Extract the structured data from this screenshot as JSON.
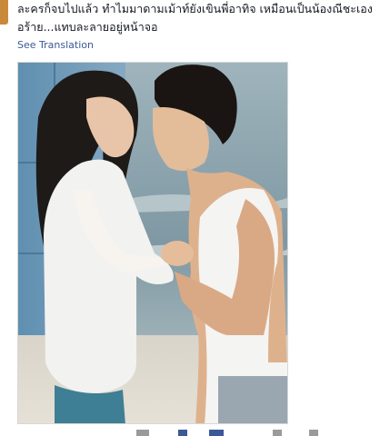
{
  "post": {
    "text_line1": "ละครก็จบไปแล้ว ทำไมมาดามเม้าท์ยังเขินพี่อาทิจ เหมือนเป็นน้องณีชะเอง",
    "text_line2": "อร้าย...แทบละลายอยู่หน้าจอ",
    "see_translation": "See Translation"
  },
  "photo": {
    "subject": "couple-on-beach-photo"
  },
  "colors": {
    "link": "#3b5998",
    "text": "#141823"
  }
}
